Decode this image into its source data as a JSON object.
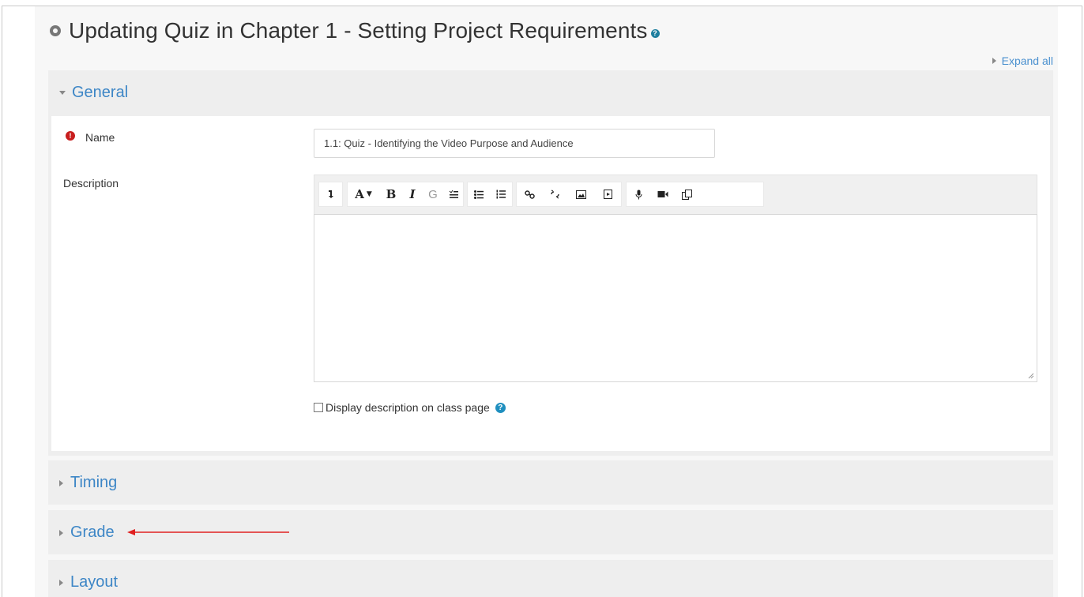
{
  "page": {
    "title": "Updating Quiz in Chapter 1 - Setting Project Requirements",
    "title_help_icon": "help-icon",
    "expand_all": "Expand all"
  },
  "sections": {
    "general": "General",
    "timing": "Timing",
    "grade": "Grade",
    "layout": "Layout"
  },
  "form": {
    "name_label": "Name",
    "name_required_icon": "required-icon",
    "name_value": "1.1: Quiz - Identifying the Video Purpose and Audience",
    "description_label": "Description",
    "display_description_label": "Display description on class page",
    "display_description_checked": false
  },
  "editor_toolbar": {
    "tools": [
      "show-more-buttons-icon",
      "font-size-icon",
      "bold-icon",
      "italic-icon",
      "accessibility-checker-icon",
      "screenreader-helper-icon",
      "unordered-list-icon",
      "ordered-list-icon",
      "link-icon",
      "unlink-icon",
      "image-icon",
      "media-icon",
      "record-audio-icon",
      "record-video-icon",
      "manage-files-icon"
    ]
  },
  "colors": {
    "link": "#3d86c6",
    "required": "#c81e1e",
    "help": "#1f8fbf",
    "annotation_arrow": "#e02020"
  }
}
